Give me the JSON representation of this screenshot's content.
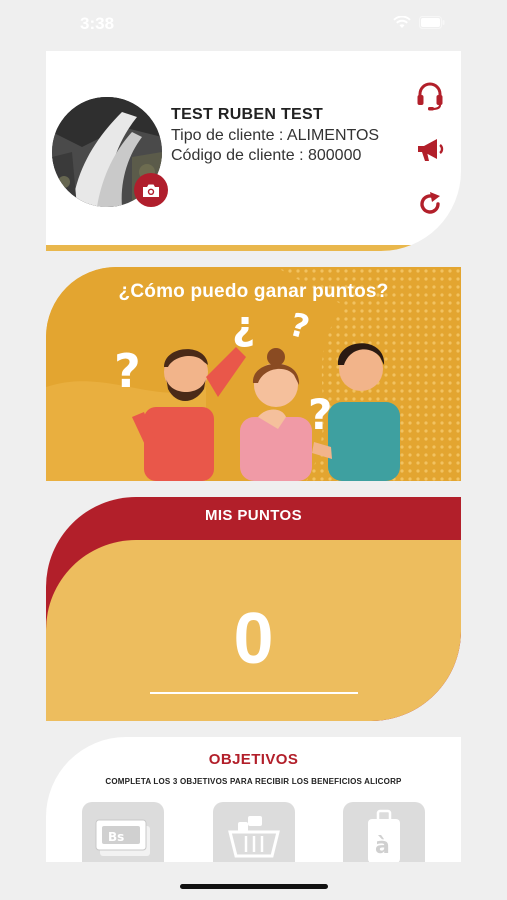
{
  "status": {
    "time": "3:38"
  },
  "profile": {
    "name": "TEST RUBEN TEST",
    "client_type": "Tipo de cliente : ALIMENTOS",
    "client_code": "Código de cliente : 800000"
  },
  "icons": {
    "support": "headset-icon",
    "announcements": "megaphone-icon",
    "refresh": "refresh-icon",
    "camera": "camera-icon"
  },
  "banner": {
    "title": "¿Cómo puedo ganar puntos?"
  },
  "points": {
    "title": "MIS PUNTOS",
    "value": "0"
  },
  "objectives": {
    "title": "OBJETIVOS",
    "subtitle": "COMPLETA LOS 3 OBJETIVOS PARA RECIBIR LOS BENEFICIOS ALICORP",
    "tiles": [
      {
        "icon": "bills-icon",
        "label": "Bs"
      },
      {
        "icon": "basket-icon",
        "label": ""
      },
      {
        "icon": "badge-icon",
        "label": "à"
      }
    ]
  },
  "colors": {
    "brand_red": "#b21f2a",
    "brand_yellow": "#eab040",
    "points_yellow": "#edbd5e"
  }
}
